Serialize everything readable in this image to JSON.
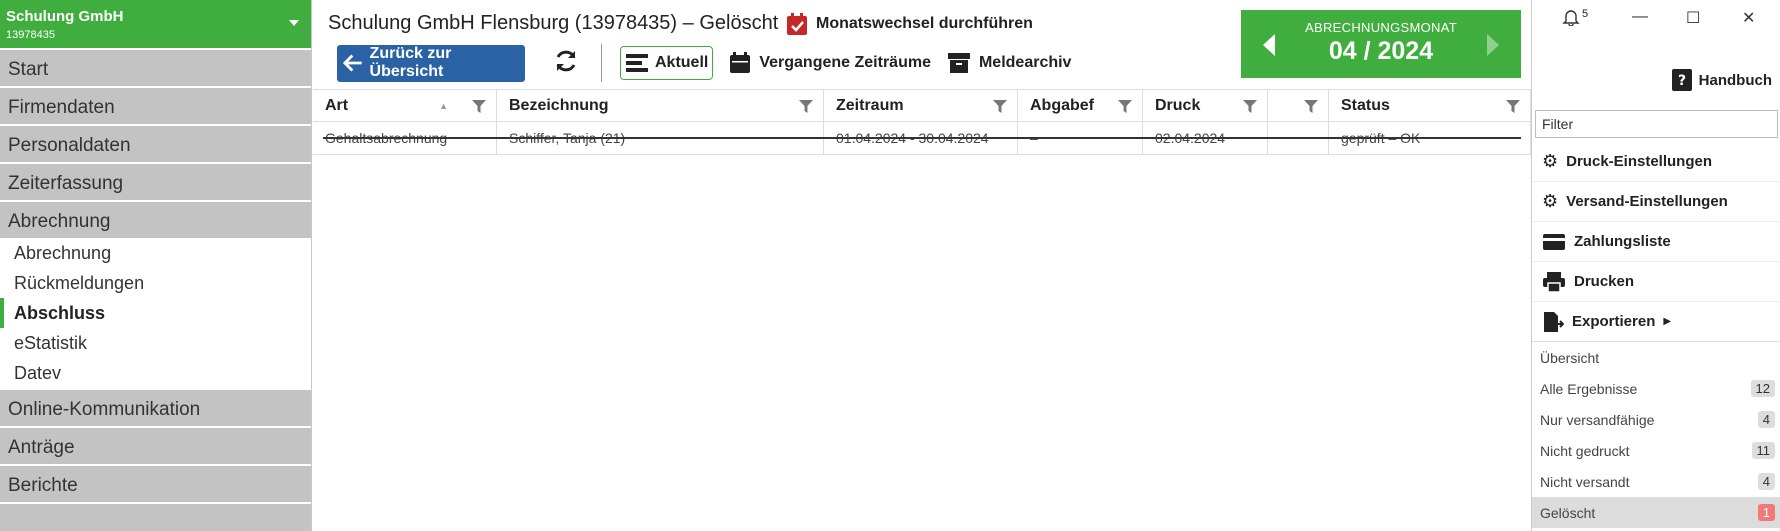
{
  "sidebar": {
    "company_name": "Schulung GmbH",
    "company_number": "13978435",
    "nav_top": [
      "Start",
      "Firmendaten",
      "Personaldaten",
      "Zeiterfassung",
      "Abrechnung"
    ],
    "sub_items": [
      "Abrechnung",
      "Rückmeldungen",
      "Abschluss",
      "eStatistik",
      "Datev"
    ],
    "nav_bottom": [
      "Online-Kommunikation",
      "Anträge",
      "Berichte"
    ]
  },
  "header": {
    "title": "Schulung GmbH Flensburg (13978435) – Gelöscht",
    "month_switch": "Monatswechsel durchführen",
    "back": "Zurück zur Übersicht",
    "aktuell": "Aktuell",
    "past": "Vergangene Zeiträume",
    "archive": "Meldearchiv"
  },
  "period": {
    "label": "ABRECHNUNGSMONAT",
    "value": "04 / 2024"
  },
  "table": {
    "columns": [
      "Art",
      "Bezeichnung",
      "Zeitraum",
      "Abgabef",
      "Druck",
      "",
      "Status"
    ],
    "rows": [
      [
        "Gehaltsabrechnung",
        "Schiffer, Tanja (21)",
        "01.04.2024 - 30.04.2024",
        "–",
        "02.04.2024",
        "",
        "geprüft – OK"
      ]
    ]
  },
  "right": {
    "notifications": "5",
    "handbuch": "Handbuch",
    "filter_placeholder": "Filter",
    "actions": [
      "Druck-Einstellungen",
      "Versand-Einstellungen",
      "Zahlungsliste",
      "Drucken",
      "Exportieren"
    ],
    "views": [
      {
        "label": "Übersicht",
        "count": ""
      },
      {
        "label": "Alle Ergebnisse",
        "count": "12"
      },
      {
        "label": "Nur versandfähige",
        "count": "4"
      },
      {
        "label": "Nicht gedruckt",
        "count": "11"
      },
      {
        "label": "Nicht versandt",
        "count": "4"
      },
      {
        "label": "Gelöscht",
        "count": "1"
      }
    ]
  },
  "colors": {
    "green": "#3fae3f",
    "blue": "#2b62a6",
    "gray_nav": "#c3c3c3",
    "badge_red": "#f07a7a"
  }
}
